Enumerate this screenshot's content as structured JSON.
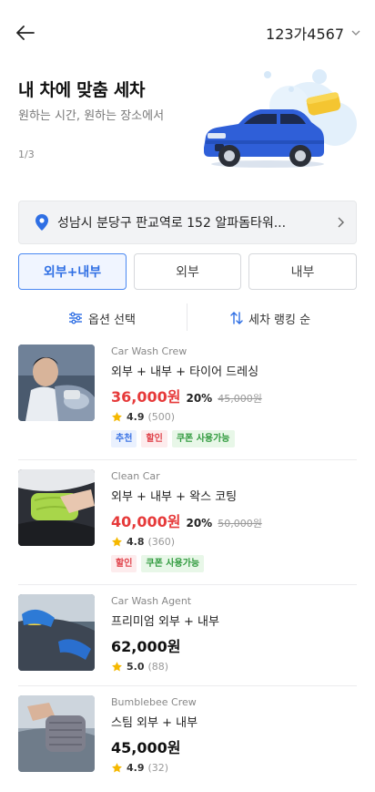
{
  "header": {
    "plate_number": "123가4567"
  },
  "hero": {
    "title": "내 차에 맞춤 세차",
    "subtitle": "원하는 시간, 원하는 장소에서",
    "page_indicator": "1/3"
  },
  "location": {
    "address": "성남시 분당구 판교역로 152 알파돔타워..."
  },
  "segments": [
    {
      "label": "외부+내부",
      "active": true
    },
    {
      "label": "외부",
      "active": false
    },
    {
      "label": "내부",
      "active": false
    }
  ],
  "sort": {
    "options_label": "옵션 선택",
    "ranking_label": "세차 랭킹 순"
  },
  "listings": [
    {
      "shop": "Car Wash Crew",
      "service": "외부 + 내부 + 타이어 드레싱",
      "price": "36,000원",
      "discount": "20%",
      "original_price": "45,000원",
      "rating": "4.9",
      "reviews": "(500)",
      "badges": [
        "추천",
        "할인",
        "쿠폰 사용가능"
      ]
    },
    {
      "shop": "Clean Car",
      "service": "외부 + 내부 + 왁스 코팅",
      "price": "40,000원",
      "discount": "20%",
      "original_price": "50,000원",
      "rating": "4.8",
      "reviews": "(360)",
      "badges": [
        "할인",
        "쿠폰 사용가능"
      ]
    },
    {
      "shop": "Car Wash Agent",
      "service": "프리미엄 외부 + 내부",
      "price": "62,000원",
      "rating": "5.0",
      "reviews": "(88)"
    },
    {
      "shop": "Bumblebee Crew",
      "service": "스팀 외부 + 내부",
      "price": "45,000원",
      "rating": "4.9",
      "reviews": "(32)"
    }
  ],
  "colors": {
    "accent": "#2f6fe4",
    "sale_price": "#e63a3a",
    "star": "#f5b800"
  }
}
